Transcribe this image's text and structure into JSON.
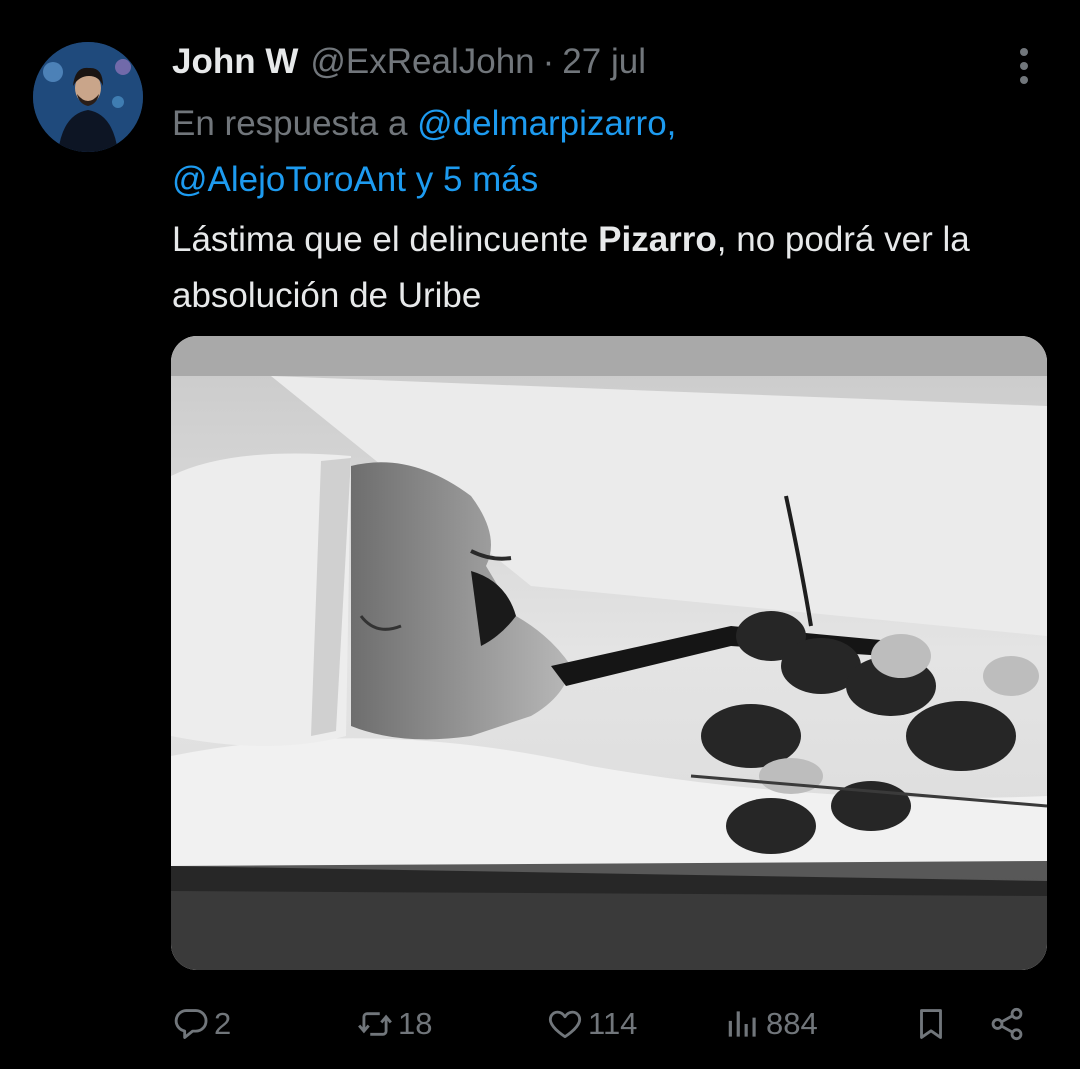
{
  "tweet": {
    "display_name": "John W",
    "handle": "@ExRealJohn",
    "separator": "·",
    "date": "27 jul",
    "reply_prefix": "En respuesta a",
    "reply_mention_1": "@delmarpizarro,",
    "reply_mention_2": "@AlejoToroAnt",
    "reply_suffix": "y 5 más",
    "text_before": "Lástima que el delincuente ",
    "text_bold": "Pizarro",
    "text_after": ", no podrá ver la absolución de Uribe"
  },
  "actions": {
    "replies": "2",
    "retweets": "18",
    "likes": "114",
    "views": "884"
  },
  "icons": {
    "reply": "reply-icon",
    "retweet": "retweet-icon",
    "like": "heart-icon",
    "views": "views-icon",
    "bookmark": "bookmark-icon",
    "share": "share-icon",
    "more": "more-icon"
  },
  "colors": {
    "background": "#000000",
    "text_primary": "#e7e9ea",
    "text_secondary": "#71767b",
    "accent": "#1d9bf0"
  }
}
